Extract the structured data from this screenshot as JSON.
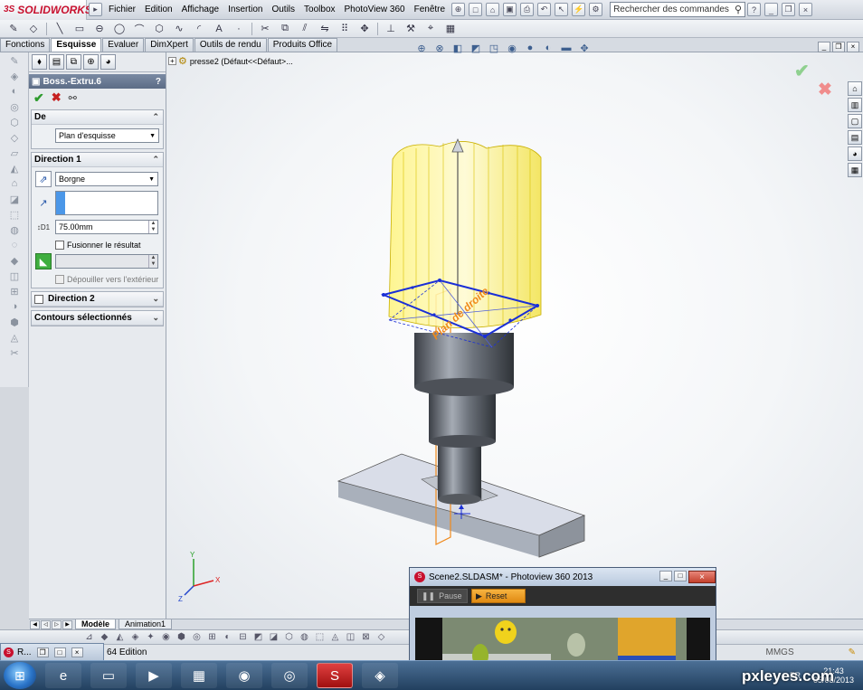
{
  "app": {
    "logo_ds": "3S",
    "logo_text": "SOLIDWORKS"
  },
  "menu": [
    "Fichier",
    "Edition",
    "Affichage",
    "Insertion",
    "Outils",
    "Toolbox",
    "PhotoView 360",
    "Fenêtre"
  ],
  "search": {
    "placeholder": "Rechercher des commandes"
  },
  "tabs": [
    {
      "label": "Fonctions",
      "active": false
    },
    {
      "label": "Esquisse",
      "active": true
    },
    {
      "label": "Evaluer",
      "active": false
    },
    {
      "label": "DimXpert",
      "active": false
    },
    {
      "label": "Outils de rendu",
      "active": false
    },
    {
      "label": "Produits Office",
      "active": false
    }
  ],
  "feature_tree": {
    "item": "presse2  (Défaut<<Défaut>..."
  },
  "property_manager": {
    "title": "Boss.-Extru.6",
    "help": "?",
    "de": {
      "header": "De",
      "value": "Plan d'esquisse"
    },
    "direction1": {
      "header": "Direction 1",
      "end_condition": "Borgne",
      "depth_label": "D1",
      "depth": "75.00mm",
      "merge_label": "Fusionner le résultat",
      "draft_label": "Dépouiller vers l'extérieur"
    },
    "direction2": {
      "header": "Direction 2"
    },
    "contours": {
      "header": "Contours sélectionnés"
    }
  },
  "model": {
    "plane_label": "Plan de droite"
  },
  "bottom_tabs": [
    {
      "label": "Modèle",
      "active": true
    },
    {
      "label": "Animation1",
      "active": false
    }
  ],
  "statusbar": {
    "edition": "64 Edition",
    "units": "MMGS"
  },
  "minimized_window": {
    "label": "R..."
  },
  "photoview": {
    "title": "Scene2.SLDASM* - Photoview 360 2013",
    "pause_label": "Pause",
    "reset_label": "Reset"
  },
  "taskbar": {
    "lang": "FR",
    "time": "21:43",
    "date": "05/08/2013"
  },
  "watermark": "pxleyes.com",
  "colors": {
    "accent": "#c8102e",
    "extrude_yellow": "#fff27a",
    "sketch_blue": "#1a2fd6",
    "plane_orange": "#f08a1c"
  }
}
